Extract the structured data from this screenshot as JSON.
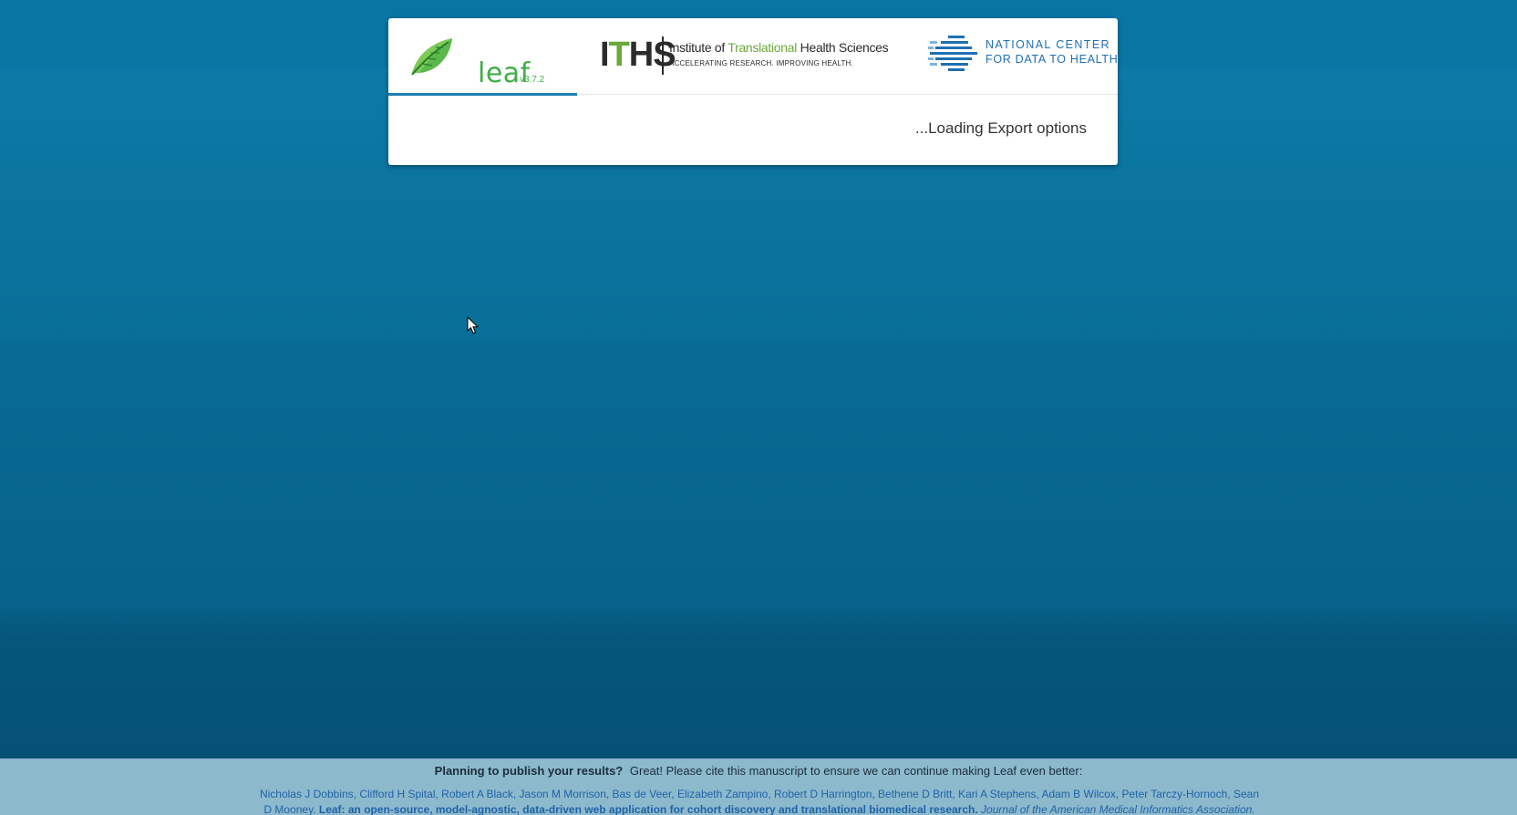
{
  "header": {
    "leaf_name": "leaf",
    "leaf_version": "v3.7.2",
    "iths_abbrev": "ITHS",
    "iths_name_prefix": "Institute of",
    "iths_name_green": "Translational",
    "iths_name_suffix": "Health Sciences",
    "iths_tagline": "ACCELERATING RESEARCH. IMPROVING HEALTH.",
    "ncdh_line1": "NATIONAL CENTER",
    "ncdh_line2": "FOR DATA TO HEALTH"
  },
  "status": {
    "loading_text": "...Loading Export options"
  },
  "footer": {
    "prompt_bold": "Planning to publish your results?",
    "prompt_text": "Great! Please cite this manuscript to ensure we can continue making Leaf even better:",
    "authors": "Nicholas J Dobbins, Clifford H Spital, Robert A Black, Jason M Morrison, Bas de Veer, Elizabeth Zampino, Robert D Harrington, Bethene D Britt, Kari A Stephens, Adam B Wilcox, Peter Tarczy-Hornoch, Sean D Mooney.",
    "paper_title": "Leaf: an open-source, model-agnostic, data-driven web application for cohort discovery and translational biomedical research.",
    "journal": "Journal of the American Medical Informatics Association."
  },
  "colors": {
    "background": "#0a77a6",
    "card": "#ffffff",
    "accent_line": "#1d7fb2",
    "leaf_green": "#3fae49",
    "iths_green": "#6aa83a",
    "ncdh_blue": "#1f6fb2",
    "footer_bg": "#8db9cd",
    "citation_link": "#1f63a6"
  },
  "icons": {
    "leaf_logo": "leaf-icon",
    "ncdh_logo": "ncdh-arrow-icon",
    "cursor": "mouse-pointer-icon"
  }
}
